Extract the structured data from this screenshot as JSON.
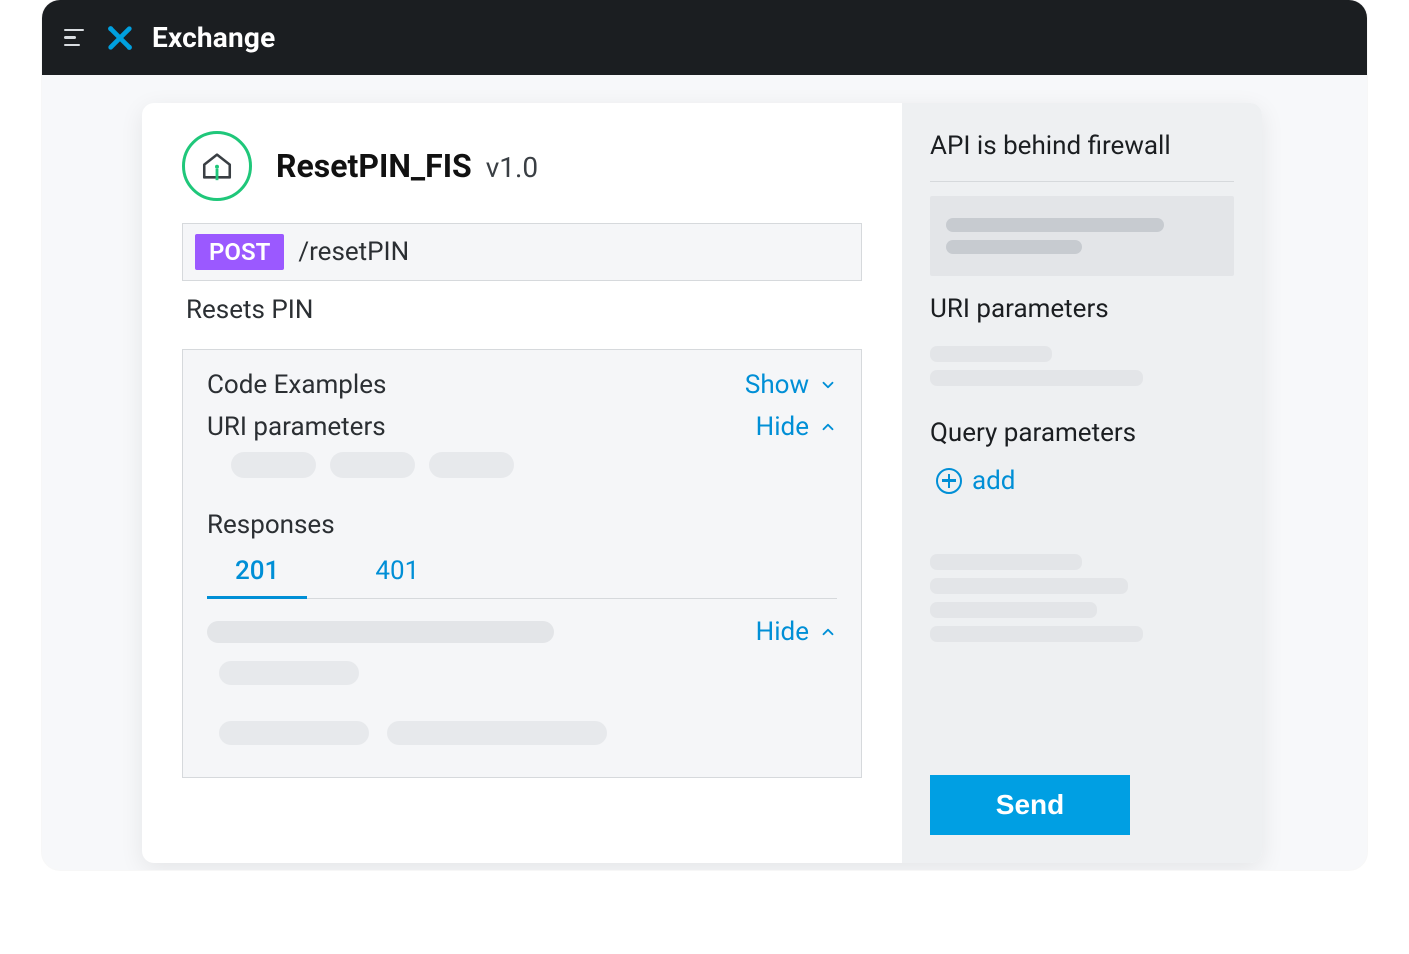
{
  "header": {
    "app_title": "Exchange"
  },
  "api": {
    "name": "ResetPIN_FIS",
    "version": "v1.0",
    "method": "POST",
    "path": "/resetPIN",
    "description": "Resets PIN"
  },
  "panel": {
    "code_examples_label": "Code Examples",
    "code_examples_toggle": "Show",
    "uri_params_label": "URI parameters",
    "uri_params_toggle": "Hide",
    "responses_label": "Responses",
    "response_tabs": [
      "201",
      "401"
    ],
    "response_body_toggle": "Hide"
  },
  "sidebar": {
    "firewall_notice": "API is behind firewall",
    "uri_params_label": "URI parameters",
    "query_params_label": "Query parameters",
    "add_label": "add",
    "send_label": "Send"
  }
}
